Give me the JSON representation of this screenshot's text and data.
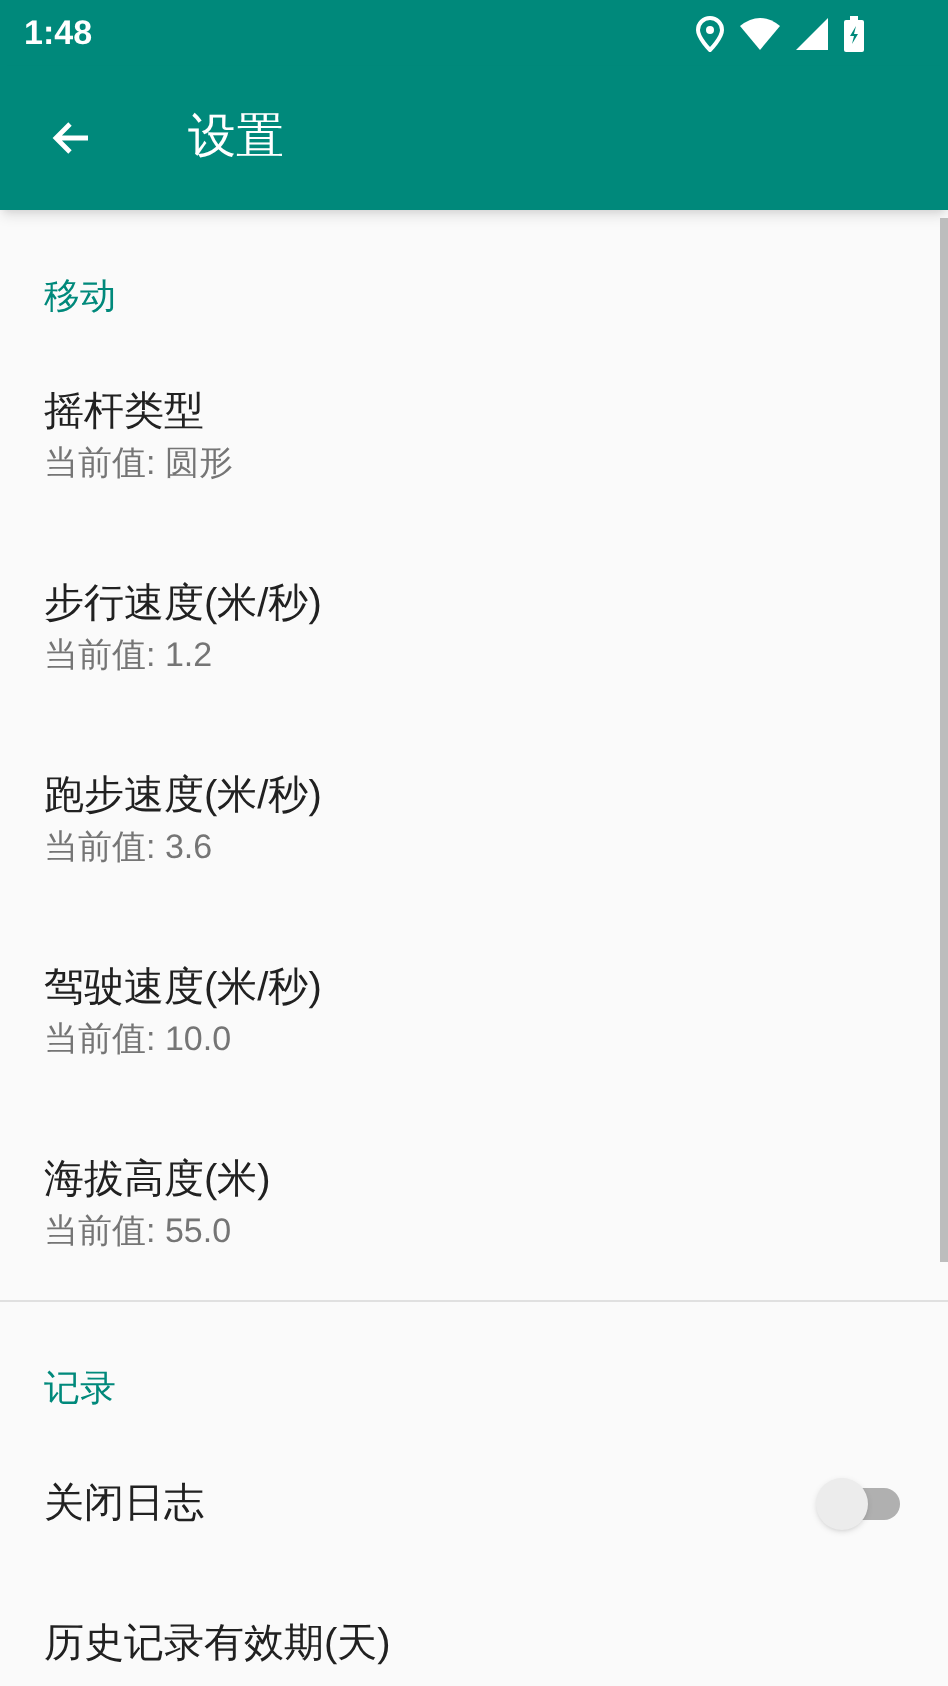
{
  "status_bar": {
    "time": "1:48"
  },
  "toolbar": {
    "title": "设置"
  },
  "sections": [
    {
      "title": "移动",
      "items": [
        {
          "kind": "summary",
          "title": "摇杆类型",
          "summary": "当前值: 圆形"
        },
        {
          "kind": "summary",
          "title": "步行速度(米/秒)",
          "summary": "当前值: 1.2"
        },
        {
          "kind": "summary",
          "title": "跑步速度(米/秒)",
          "summary": "当前值: 3.6"
        },
        {
          "kind": "summary",
          "title": "驾驶速度(米/秒)",
          "summary": "当前值: 10.0"
        },
        {
          "kind": "summary",
          "title": "海拔高度(米)",
          "summary": "当前值: 55.0"
        }
      ]
    },
    {
      "title": "记录",
      "items": [
        {
          "kind": "switch",
          "title": "关闭日志",
          "on": false
        },
        {
          "kind": "plain",
          "title": "历史记录有效期(天)"
        }
      ]
    }
  ]
}
